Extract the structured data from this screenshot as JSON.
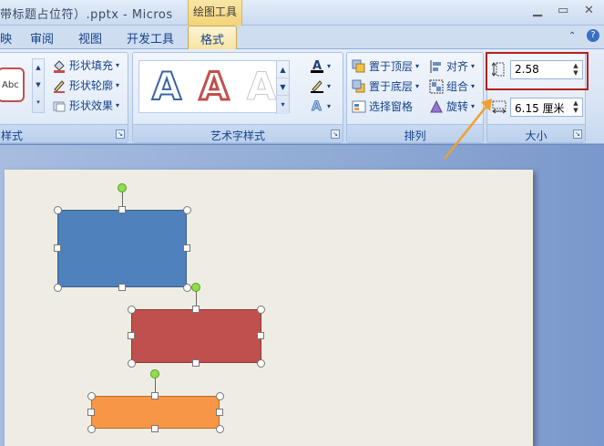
{
  "titlebar": {
    "title": "带标题占位符）.pptx - Micros",
    "context_tools": "绘图工具"
  },
  "tabs": [
    {
      "label": "映",
      "active": false
    },
    {
      "label": "审阅",
      "active": false
    },
    {
      "label": "视图",
      "active": false
    },
    {
      "label": "开发工具",
      "active": false
    },
    {
      "label": "格式",
      "active": true
    }
  ],
  "ribbon": {
    "shape_styles": {
      "label": "样式",
      "preview_text": "Abc",
      "fill_label": "形状填充",
      "outline_label": "形状轮廓",
      "effects_label": "形状效果"
    },
    "wordart_styles": {
      "label": "艺术字样式",
      "samples": [
        "A",
        "A",
        "A"
      ]
    },
    "arrange": {
      "label": "排列",
      "bring_front": "置于顶层",
      "send_back": "置于底层",
      "selection_pane": "选择窗格",
      "align": "对齐",
      "group": "组合",
      "rotate": "旋转"
    },
    "size": {
      "label": "大小",
      "height_value": "2.58",
      "width_value": "6.15 厘米"
    }
  },
  "colors": {
    "blue_shape": "#4f81bd",
    "red_shape": "#c0504d",
    "orange_shape": "#f79646",
    "highlight_box": "#b22222",
    "arrow": "#f0a030"
  }
}
